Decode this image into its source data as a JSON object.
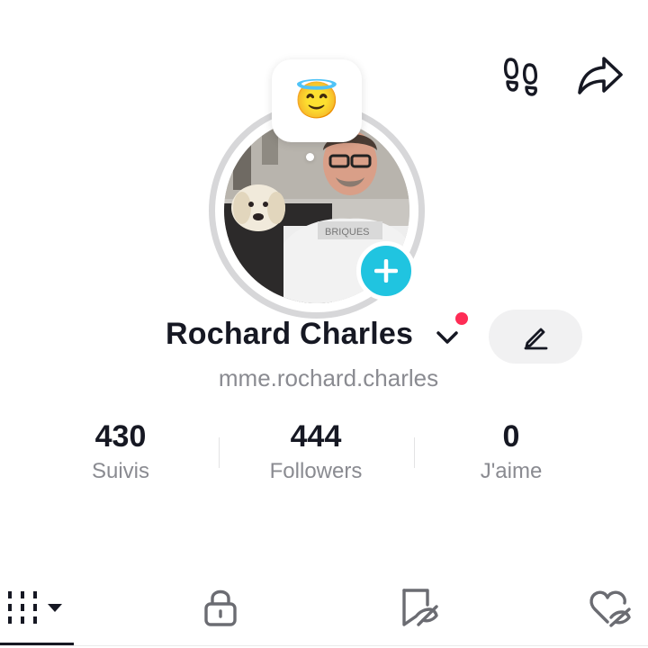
{
  "header": {
    "footprints_icon": "footprints-icon",
    "share_icon": "share-arrow-icon"
  },
  "profile": {
    "avatar_icon": "profile-photo",
    "status_emoji": "😇",
    "add_icon": "plus-icon",
    "display_name": "Rochard Charles",
    "username": "mme.rochard.charles",
    "edit_icon": "pencil-icon"
  },
  "stats": [
    {
      "value": "430",
      "label": "Suivis"
    },
    {
      "value": "444",
      "label": "Followers"
    },
    {
      "value": "0",
      "label": "J'aime"
    }
  ],
  "tabs": [
    {
      "icon": "grid-icon",
      "active": true
    },
    {
      "icon": "lock-icon",
      "active": false
    },
    {
      "icon": "bookmark-hidden-icon",
      "active": false
    },
    {
      "icon": "heart-hidden-icon",
      "active": false
    }
  ],
  "colors": {
    "accent": "#20c4e0",
    "notification": "#fe2c55",
    "text": "#161823",
    "muted": "#8a8b91"
  }
}
